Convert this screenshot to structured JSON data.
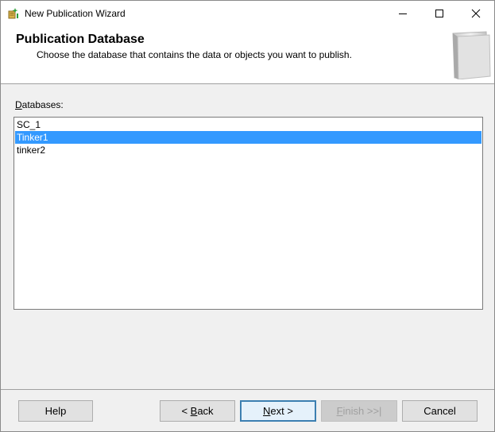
{
  "window": {
    "title": "New Publication Wizard",
    "icon": "wizard-icon"
  },
  "header": {
    "title": "Publication Database",
    "subtitle": "Choose the database that contains the data or objects you want to publish."
  },
  "databases": {
    "label_accel": "D",
    "label_rest": "atabases:",
    "items": [
      {
        "label": "SC_1",
        "selected": false
      },
      {
        "label": "Tinker1",
        "selected": true
      },
      {
        "label": "tinker2",
        "selected": false
      }
    ]
  },
  "footer": {
    "help": "Help",
    "back_prefix": "< ",
    "back_accel": "B",
    "back_rest": "ack",
    "next_accel": "N",
    "next_rest": "ext >",
    "finish_accel": "F",
    "finish_rest": "inish >>|",
    "cancel": "Cancel"
  },
  "colors": {
    "selection": "#3399ff",
    "default_button_border": "#3c7fb1"
  }
}
